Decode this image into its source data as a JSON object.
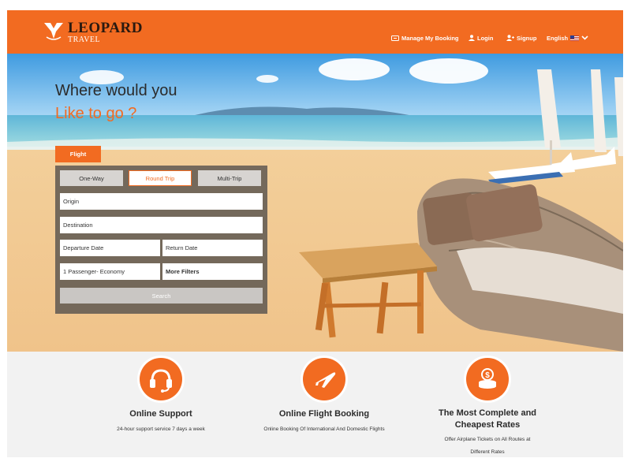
{
  "brand": {
    "name": "LEOPARD",
    "tagline": "TRAVEL"
  },
  "nav": {
    "manage_booking": "Manage My Booking",
    "login": "Login",
    "signup": "Signup",
    "language": "English"
  },
  "hero": {
    "headline_line1": "Where would you",
    "headline_line2": "Like to go ?"
  },
  "search": {
    "tab_label": "Flight",
    "trip_types": [
      "One-Way",
      "Round Trip",
      "Multi-Trip"
    ],
    "selected_trip_type": "Round Trip",
    "origin_placeholder": "Origin",
    "destination_placeholder": "Destination",
    "departure_placeholder": "Departure Date",
    "return_placeholder": "Return Date",
    "passengers_value": "1 Passenger- Economy",
    "more_filters_label": "More Filters",
    "search_button_label": "Search"
  },
  "features": [
    {
      "icon": "headset-icon",
      "title": "Online Support",
      "description": "24-hour support service 7 days a week"
    },
    {
      "icon": "airplane-icon",
      "title": "Online Flight Booking",
      "description": "Online Booking Of International And Domestic Flights"
    },
    {
      "icon": "coins-icon",
      "title": "The Most Complete and Cheapest Rates",
      "title_line1": "The Most Complete and",
      "title_line2": "Cheapest Rates",
      "description_line1": "Offer Airplane Tickets on All Routes at",
      "description_line2": "Different Rates"
    }
  ],
  "colors": {
    "accent": "#f26b21",
    "panel": "#5f5852",
    "light_bg": "#f2f2f2"
  }
}
